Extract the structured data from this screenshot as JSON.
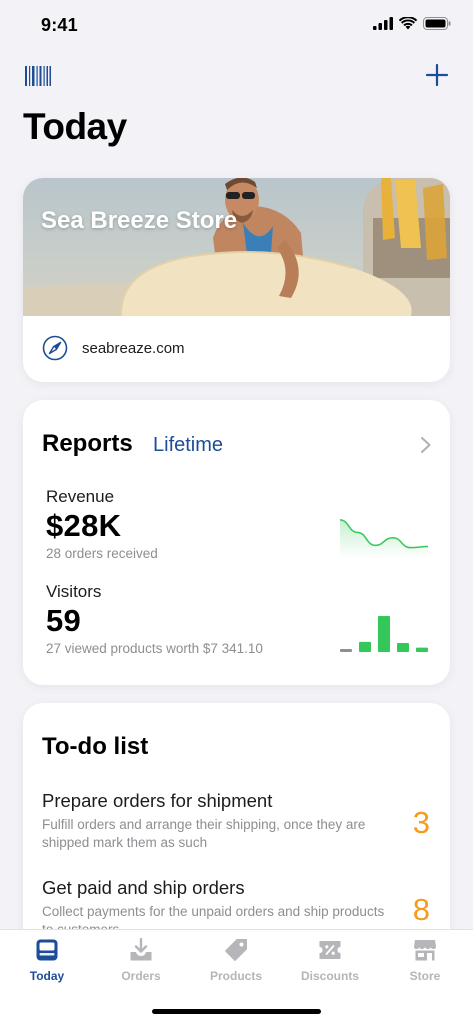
{
  "status_bar": {
    "time": "9:41"
  },
  "nav": {
    "barcode_icon": "barcode-icon",
    "add_icon": "plus-icon"
  },
  "page": {
    "title": "Today"
  },
  "store": {
    "name": "Sea Breeze Store",
    "url": "seabreaze.com",
    "url_icon": "compass-icon"
  },
  "reports": {
    "title": "Reports",
    "range": "Lifetime",
    "revenue": {
      "label": "Revenue",
      "value": "$28K",
      "sub": "28 orders received",
      "trend": [
        0.95,
        0.62,
        0.28,
        0.48,
        0.22,
        0.25
      ]
    },
    "visitors": {
      "label": "Visitors",
      "value": "59",
      "sub": "27 viewed products worth $7 341.10",
      "bars": [
        0.08,
        0.28,
        1.0,
        0.25,
        0.12
      ]
    },
    "colors": {
      "accent": "#1e4d97",
      "chart": "#34c759",
      "muted": "#8e8e93"
    }
  },
  "todo": {
    "title": "To-do list",
    "items": [
      {
        "title": "Prepare orders for shipment",
        "description": "Fulfill orders and arrange their shipping, once they are shipped mark them as such",
        "count": "3"
      },
      {
        "title": "Get paid and ship orders",
        "description": "Collect payments for the unpaid orders and ship products to customers",
        "count": "8"
      }
    ],
    "count_color": "#f59b1d"
  },
  "tabs": [
    {
      "label": "Today",
      "icon": "today-icon",
      "active": true
    },
    {
      "label": "Orders",
      "icon": "tray-download-icon",
      "active": false
    },
    {
      "label": "Products",
      "icon": "tag-icon",
      "active": false
    },
    {
      "label": "Discounts",
      "icon": "discount-ticket-icon",
      "active": false
    },
    {
      "label": "Store",
      "icon": "storefront-icon",
      "active": false
    }
  ]
}
